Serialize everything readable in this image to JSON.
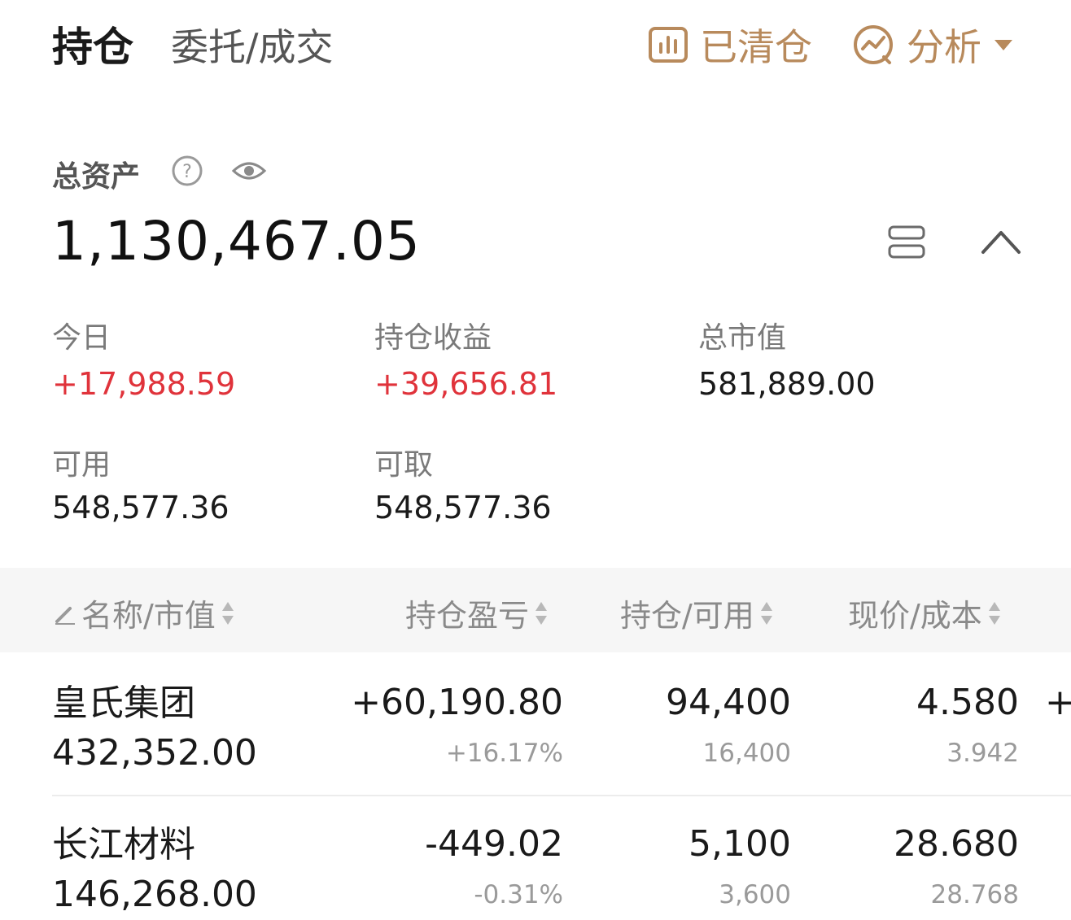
{
  "tabs": {
    "positions": "持仓",
    "orders": "委托/成交"
  },
  "header": {
    "cleared_label": "已清仓",
    "analysis_label": "分析"
  },
  "summary": {
    "total_assets_label": "总资产",
    "total_assets_value": "1,130,467.05",
    "today_label": "今日",
    "today_value": "+17,988.59",
    "position_pnl_label": "持仓收益",
    "position_pnl_value": "+39,656.81",
    "market_value_label": "总市值",
    "market_value_value": "581,889.00",
    "available_label": "可用",
    "available_value": "548,577.36",
    "withdrawable_label": "可取",
    "withdrawable_value": "548,577.36"
  },
  "table": {
    "headers": {
      "name": "名称/市值",
      "pnl": "持仓盈亏",
      "position": "持仓/可用",
      "price": "现价/成本"
    },
    "rows": [
      {
        "name": "皇氏集团",
        "market_value": "432,352.00",
        "pnl": "+60,190.80",
        "pnl_pct": "+16.17%",
        "position": "94,400",
        "available": "16,400",
        "price": "4.580",
        "cost": "3.942",
        "extra": "+"
      },
      {
        "name": "长江材料",
        "market_value": "146,268.00",
        "pnl": "-449.02",
        "pnl_pct": "-0.31%",
        "position": "5,100",
        "available": "3,600",
        "price": "28.680",
        "cost": "28.768"
      }
    ]
  },
  "colors": {
    "accent": "#b88a5c",
    "up": "#e0333b",
    "down": "#1aa05a"
  }
}
